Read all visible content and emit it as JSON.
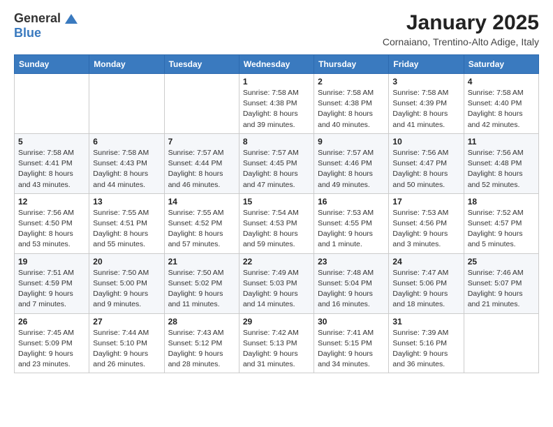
{
  "header": {
    "logo_general": "General",
    "logo_blue": "Blue",
    "title": "January 2025",
    "subtitle": "Cornaiano, Trentino-Alto Adige, Italy"
  },
  "columns": [
    "Sunday",
    "Monday",
    "Tuesday",
    "Wednesday",
    "Thursday",
    "Friday",
    "Saturday"
  ],
  "weeks": [
    [
      {
        "day": "",
        "info": ""
      },
      {
        "day": "",
        "info": ""
      },
      {
        "day": "",
        "info": ""
      },
      {
        "day": "1",
        "info": "Sunrise: 7:58 AM\nSunset: 4:38 PM\nDaylight: 8 hours\nand 39 minutes."
      },
      {
        "day": "2",
        "info": "Sunrise: 7:58 AM\nSunset: 4:38 PM\nDaylight: 8 hours\nand 40 minutes."
      },
      {
        "day": "3",
        "info": "Sunrise: 7:58 AM\nSunset: 4:39 PM\nDaylight: 8 hours\nand 41 minutes."
      },
      {
        "day": "4",
        "info": "Sunrise: 7:58 AM\nSunset: 4:40 PM\nDaylight: 8 hours\nand 42 minutes."
      }
    ],
    [
      {
        "day": "5",
        "info": "Sunrise: 7:58 AM\nSunset: 4:41 PM\nDaylight: 8 hours\nand 43 minutes."
      },
      {
        "day": "6",
        "info": "Sunrise: 7:58 AM\nSunset: 4:43 PM\nDaylight: 8 hours\nand 44 minutes."
      },
      {
        "day": "7",
        "info": "Sunrise: 7:57 AM\nSunset: 4:44 PM\nDaylight: 8 hours\nand 46 minutes."
      },
      {
        "day": "8",
        "info": "Sunrise: 7:57 AM\nSunset: 4:45 PM\nDaylight: 8 hours\nand 47 minutes."
      },
      {
        "day": "9",
        "info": "Sunrise: 7:57 AM\nSunset: 4:46 PM\nDaylight: 8 hours\nand 49 minutes."
      },
      {
        "day": "10",
        "info": "Sunrise: 7:56 AM\nSunset: 4:47 PM\nDaylight: 8 hours\nand 50 minutes."
      },
      {
        "day": "11",
        "info": "Sunrise: 7:56 AM\nSunset: 4:48 PM\nDaylight: 8 hours\nand 52 minutes."
      }
    ],
    [
      {
        "day": "12",
        "info": "Sunrise: 7:56 AM\nSunset: 4:50 PM\nDaylight: 8 hours\nand 53 minutes."
      },
      {
        "day": "13",
        "info": "Sunrise: 7:55 AM\nSunset: 4:51 PM\nDaylight: 8 hours\nand 55 minutes."
      },
      {
        "day": "14",
        "info": "Sunrise: 7:55 AM\nSunset: 4:52 PM\nDaylight: 8 hours\nand 57 minutes."
      },
      {
        "day": "15",
        "info": "Sunrise: 7:54 AM\nSunset: 4:53 PM\nDaylight: 8 hours\nand 59 minutes."
      },
      {
        "day": "16",
        "info": "Sunrise: 7:53 AM\nSunset: 4:55 PM\nDaylight: 9 hours\nand 1 minute."
      },
      {
        "day": "17",
        "info": "Sunrise: 7:53 AM\nSunset: 4:56 PM\nDaylight: 9 hours\nand 3 minutes."
      },
      {
        "day": "18",
        "info": "Sunrise: 7:52 AM\nSunset: 4:57 PM\nDaylight: 9 hours\nand 5 minutes."
      }
    ],
    [
      {
        "day": "19",
        "info": "Sunrise: 7:51 AM\nSunset: 4:59 PM\nDaylight: 9 hours\nand 7 minutes."
      },
      {
        "day": "20",
        "info": "Sunrise: 7:50 AM\nSunset: 5:00 PM\nDaylight: 9 hours\nand 9 minutes."
      },
      {
        "day": "21",
        "info": "Sunrise: 7:50 AM\nSunset: 5:02 PM\nDaylight: 9 hours\nand 11 minutes."
      },
      {
        "day": "22",
        "info": "Sunrise: 7:49 AM\nSunset: 5:03 PM\nDaylight: 9 hours\nand 14 minutes."
      },
      {
        "day": "23",
        "info": "Sunrise: 7:48 AM\nSunset: 5:04 PM\nDaylight: 9 hours\nand 16 minutes."
      },
      {
        "day": "24",
        "info": "Sunrise: 7:47 AM\nSunset: 5:06 PM\nDaylight: 9 hours\nand 18 minutes."
      },
      {
        "day": "25",
        "info": "Sunrise: 7:46 AM\nSunset: 5:07 PM\nDaylight: 9 hours\nand 21 minutes."
      }
    ],
    [
      {
        "day": "26",
        "info": "Sunrise: 7:45 AM\nSunset: 5:09 PM\nDaylight: 9 hours\nand 23 minutes."
      },
      {
        "day": "27",
        "info": "Sunrise: 7:44 AM\nSunset: 5:10 PM\nDaylight: 9 hours\nand 26 minutes."
      },
      {
        "day": "28",
        "info": "Sunrise: 7:43 AM\nSunset: 5:12 PM\nDaylight: 9 hours\nand 28 minutes."
      },
      {
        "day": "29",
        "info": "Sunrise: 7:42 AM\nSunset: 5:13 PM\nDaylight: 9 hours\nand 31 minutes."
      },
      {
        "day": "30",
        "info": "Sunrise: 7:41 AM\nSunset: 5:15 PM\nDaylight: 9 hours\nand 34 minutes."
      },
      {
        "day": "31",
        "info": "Sunrise: 7:39 AM\nSunset: 5:16 PM\nDaylight: 9 hours\nand 36 minutes."
      },
      {
        "day": "",
        "info": ""
      }
    ]
  ]
}
